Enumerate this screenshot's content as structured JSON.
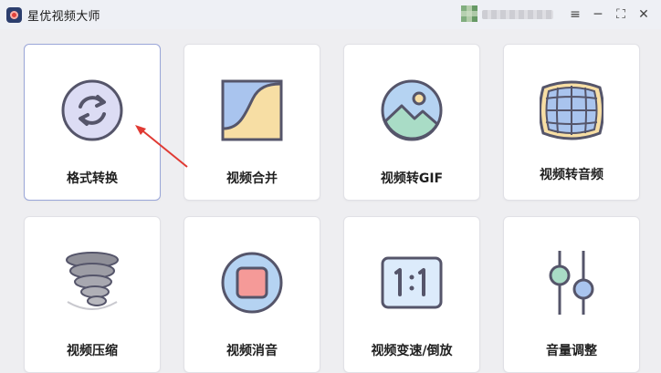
{
  "window": {
    "title": "星优视频大师",
    "controls": {
      "menu": "≡",
      "minimize": "─",
      "maximize": "⛶",
      "close": "✕"
    }
  },
  "cards": [
    {
      "label": "格式转换",
      "icon": "convert-icon",
      "selected": true
    },
    {
      "label": "视频合并",
      "icon": "merge-icon"
    },
    {
      "label": "视频转GIF",
      "icon": "image-landscape-icon"
    },
    {
      "label": "视频转音频",
      "icon": "audio-icon"
    },
    {
      "label": "视频压缩",
      "icon": "tornado-icon"
    },
    {
      "label": "视频消音",
      "icon": "stop-icon"
    },
    {
      "label": "视频变速/倒放",
      "icon": "ratio-icon"
    },
    {
      "label": "音量调整",
      "icon": "slider-icon"
    }
  ],
  "annotation": {
    "arrow_color": "#e03a33"
  },
  "colors": {
    "accent": "#9aa6d8",
    "icon_stroke": "#555566"
  }
}
